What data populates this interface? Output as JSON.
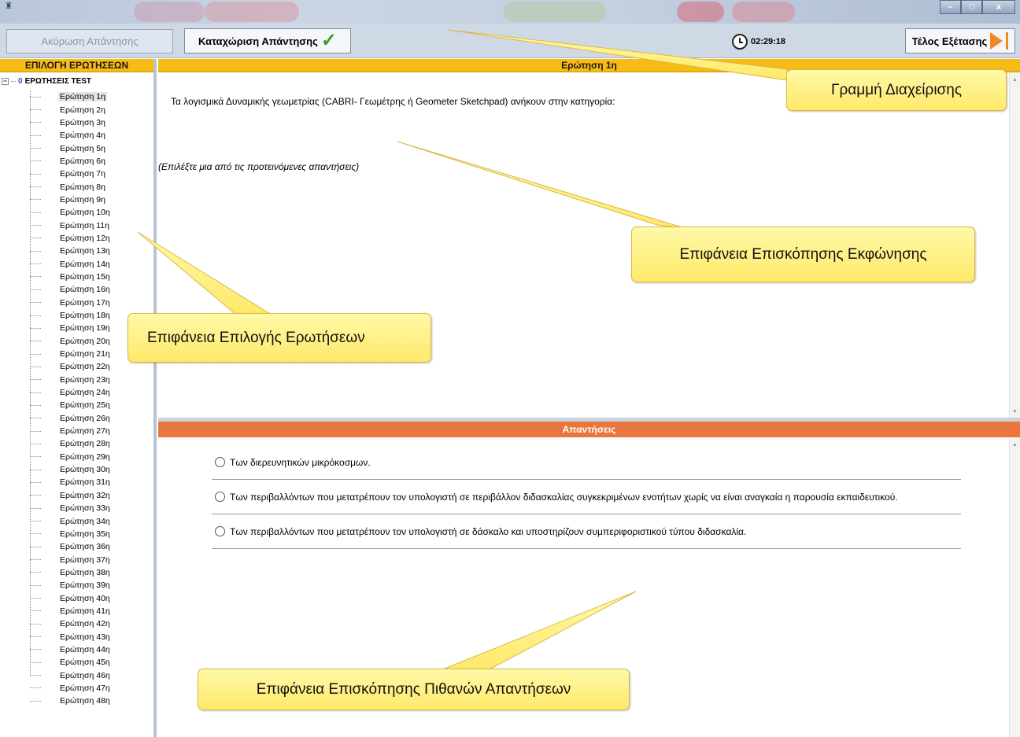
{
  "toolbar": {
    "cancel_label": "Ακύρωση Απάντησης",
    "submit_label": "Καταχώριση Απάντησης",
    "timer": "02:29:18",
    "end_label": "Τέλος Εξέτασης"
  },
  "left_panel": {
    "header": "ΕΠΙΛΟΓΗ ΕΡΩΤΗΣΕΩΝ",
    "root_count": "0",
    "root_label": "ΕΡΩΤΗΣΕΙΣ TEST",
    "questions": [
      "Ερώτηση 1η",
      "Ερώτηση 2η",
      "Ερώτηση 3η",
      "Ερώτηση 4η",
      "Ερώτηση 5η",
      "Ερώτηση 6η",
      "Ερώτηση 7η",
      "Ερώτηση 8η",
      "Ερώτηση 9η",
      "Ερώτηση 10η",
      "Ερώτηση 11η",
      "Ερώτηση 12η",
      "Ερώτηση 13η",
      "Ερώτηση 14η",
      "Ερώτηση 15η",
      "Ερώτηση 16η",
      "Ερώτηση 17η",
      "Ερώτηση 18η",
      "Ερώτηση 19η",
      "Ερώτηση 20η",
      "Ερώτηση 21η",
      "Ερώτηση 22η",
      "Ερώτηση 23η",
      "Ερώτηση 24η",
      "Ερώτηση 25η",
      "Ερώτηση 26η",
      "Ερώτηση 27η",
      "Ερώτηση 28η",
      "Ερώτηση 29η",
      "Ερώτηση 30η",
      "Ερώτηση 31η",
      "Ερώτηση 32η",
      "Ερώτηση 33η",
      "Ερώτηση 34η",
      "Ερώτηση 35η",
      "Ερώτηση 36η",
      "Ερώτηση 37η",
      "Ερώτηση 38η",
      "Ερώτηση 39η",
      "Ερώτηση 40η",
      "Ερώτηση 41η",
      "Ερώτηση 42η",
      "Ερώτηση 43η",
      "Ερώτηση 44η",
      "Ερώτηση 45η",
      "Ερώτηση 46η",
      "Ερώτηση 47η",
      "Ερώτηση 48η"
    ],
    "selected_index": 0
  },
  "question_panel": {
    "header": "Ερώτηση 1η",
    "text": "Τα λογισμικά  Δυναμικής γεωμετρίας (CABRI- Γεωμέτρης ή Geometer Sketchpad) ανήκουν στην κατηγορία:",
    "hint": "(Επιλέξτε μια από τις προτεινόμενες απαντήσεις)"
  },
  "answers_panel": {
    "header": "Απαντήσεις",
    "options": [
      "Των διερευνητικών μικρόκοσμων.",
      "Των περιβαλλόντων που μετατρέπουν τον υπολογιστή σε περιβάλλον διδασκαλίας συγκεκριμένων ενοτήτων χωρίς να είναι αναγκαία η παρουσία εκπαιδευτικού.",
      "Των περιβαλλόντων που μετατρέπουν τον υπολογιστή σε δάσκαλο και υποστηρίζουν συμπεριφοριστικού τύπου διδασκαλία."
    ]
  },
  "callouts": {
    "management_bar": "Γραμμή Διαχείρισης",
    "statement_view": "Επιφάνεια Επισκόπησης Εκφώνησης",
    "question_select": "Επιφάνεια Επιλογής Ερωτήσεων",
    "answers_view": "Επιφάνεια Επισκόπησης Πιθανών Απαντήσεων"
  },
  "colors": {
    "header_yellow": "#f6bb14",
    "header_orange": "#e8763d",
    "callout_fill": "#ffef7a",
    "check_green": "#3a9a2a",
    "play_orange": "#f08a24"
  },
  "icons": {
    "app": "app-icon",
    "submit": "check-icon",
    "timer": "clock-icon",
    "end": "play-icon"
  }
}
